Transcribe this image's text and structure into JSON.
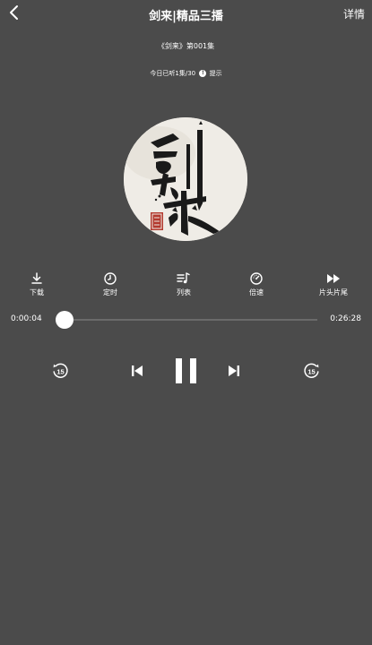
{
  "header": {
    "title": "剑来|精品三播",
    "details_label": "详情"
  },
  "episode_title": "《剑来》第001集",
  "listen_info": {
    "text": "今日已听1集/30",
    "tip_label": "提示"
  },
  "cover": {
    "calligraphy": "剑来"
  },
  "toolbar": {
    "items": [
      {
        "label": "下载",
        "icon": "download-icon"
      },
      {
        "label": "定时",
        "icon": "clock-icon"
      },
      {
        "label": "列表",
        "icon": "playlist-icon"
      },
      {
        "label": "倍速",
        "icon": "speed-icon"
      },
      {
        "label": "片头片尾",
        "icon": "skip-intro-icon"
      }
    ]
  },
  "progress": {
    "current_time": "0:00:04",
    "total_time": "0:26:28",
    "fraction": 0.0025
  },
  "controls": {
    "rewind_seconds": "15",
    "forward_seconds": "15",
    "state": "playing"
  },
  "colors": {
    "background": "#4b4b4b",
    "foreground": "#ffffff",
    "track": "#6a6a6a"
  }
}
